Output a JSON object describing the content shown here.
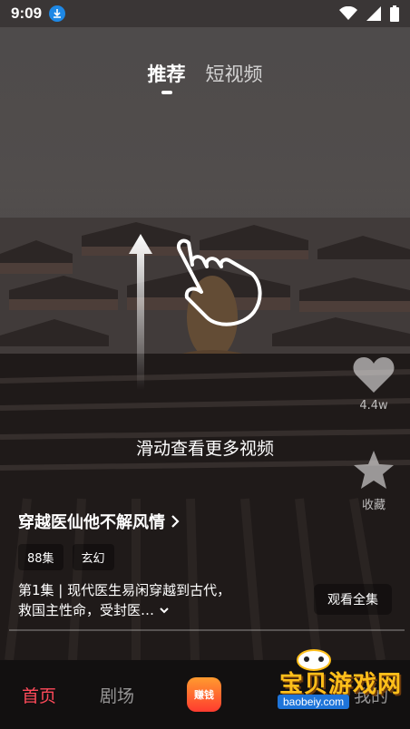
{
  "status_bar": {
    "time": "9:09"
  },
  "top_tabs": [
    {
      "label": "推荐",
      "active": true
    },
    {
      "label": "短视频",
      "active": false
    }
  ],
  "swipe_hint": "滑动查看更多视频",
  "actions": {
    "like_count": "4.4w",
    "favorite_label": "收藏"
  },
  "drama": {
    "title": "穿越医仙他不解风情",
    "tags": [
      "88集",
      "玄幻"
    ],
    "description": "第1集 | 现代医生易闲穿越到古代，救国主性命，受封医…",
    "watch_all": "观看全集"
  },
  "bottom_nav": {
    "items": [
      "首页",
      "剧场",
      "我的"
    ],
    "earn_label": "赚钱",
    "active_index": 0
  },
  "watermark": {
    "text": "宝贝游戏网",
    "url": "baobeiy.com"
  },
  "colors": {
    "accent": "#ff4a5a",
    "nav_bg": "#121010",
    "watermark": "#ffbf1a"
  }
}
